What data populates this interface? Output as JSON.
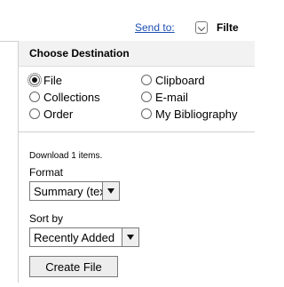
{
  "topbar": {
    "send_to_label": "Send to:",
    "filter_label": "Filte"
  },
  "destination": {
    "title": "Choose Destination",
    "options": [
      {
        "label": "File",
        "selected": true
      },
      {
        "label": "Clipboard",
        "selected": false
      },
      {
        "label": "Collections",
        "selected": false
      },
      {
        "label": "E-mail",
        "selected": false
      },
      {
        "label": "Order",
        "selected": false
      },
      {
        "label": "My Bibliography",
        "selected": false
      }
    ]
  },
  "download": {
    "count_text": "Download 1 items.",
    "format_label": "Format",
    "format_value": "Summary (text)",
    "sort_label": "Sort by",
    "sort_value": "Recently Added",
    "create_button": "Create File"
  },
  "colors": {
    "link": "#1e4fb3",
    "header_bg": "#f2f2f2",
    "border": "#cfcfcf"
  },
  "icons": {
    "send_to_dropdown": "chevron-down-icon",
    "select_arrow": "triangle-down-icon"
  }
}
